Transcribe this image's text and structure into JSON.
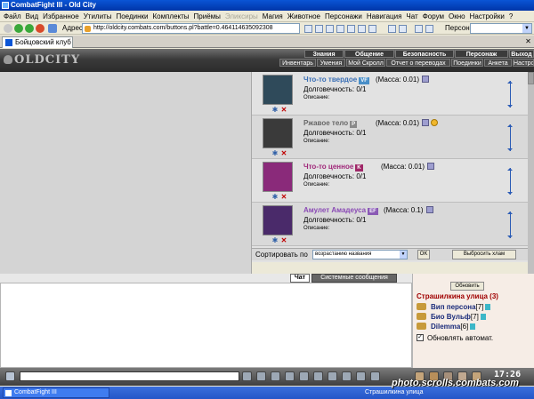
{
  "window": {
    "title": "CombatFight III - Old City"
  },
  "menu": [
    "Файл",
    "Вид",
    "Избранное",
    "Утилиты",
    "Поединки",
    "Комплекты",
    "Приёмы",
    "Эликсиры",
    "Магия",
    "Животное",
    "Персонажи",
    "Навигация",
    "Чат",
    "Форум",
    "Окно",
    "Настройки",
    "?"
  ],
  "address": {
    "label": "Адрес",
    "url": "http://oldcity.combats.com/buttons.pl?battle=0.464114635092308",
    "persona_label": "Персонаж:"
  },
  "tab": {
    "label": "Бойцовский клуб"
  },
  "game": {
    "logo": "OLDCITY",
    "nav_top": [
      "Знания",
      "Общение",
      "Безопасность",
      "Персонаж",
      "Выход"
    ],
    "nav_bottom": [
      "Инвентарь",
      "Умения",
      "Мой Скролл",
      "Отчет о переводах",
      "Поединки",
      "Анкета",
      "Настро"
    ]
  },
  "inventory": {
    "mass_label": "Масса:",
    "durability_label": "Долговечность:",
    "description_label": "Описание:",
    "items": [
      {
        "name": "Что-то твердое",
        "badge": "VF",
        "badge_color": "#4a8fc8",
        "name_color": "#3a6fb5",
        "mass": "(Масса: 0.01)",
        "durability": "0/1",
        "img_color": "#2f4a5a"
      },
      {
        "name": "Ржавое тело",
        "badge": "P",
        "badge_color": "#8a8a8a",
        "name_color": "#666666",
        "mass": "(Масса: 0.01)",
        "durability": "0/1",
        "img_color": "#3a3a3a"
      },
      {
        "name": "Что-то ценное",
        "badge": "K",
        "badge_color": "#a02868",
        "name_color": "#a0287a",
        "mass": "(Масса: 0.01)",
        "durability": "0/1",
        "img_color": "#8a2a7a"
      },
      {
        "name": "Амулет Амадеуса",
        "badge": "EF",
        "badge_color": "#8a5ab5",
        "name_color": "#8a4ab5",
        "mass": "(Масса: 0.1)",
        "durability": "0/1",
        "img_color": "#4a2a6a"
      }
    ],
    "sort_label": "Сортировать по",
    "sort_value": "возрастанию названия",
    "ok_label": "OK",
    "junk_label": "Выбросить хлам"
  },
  "chat": {
    "tab_chat": "Чат",
    "tab_system": "Системные сообщения"
  },
  "users": {
    "refresh_label": "Обновить",
    "location": "Страшилкина улица (3)",
    "list": [
      {
        "name": "Вип персона",
        "level": "[7]"
      },
      {
        "name": "Био Вульф",
        "level": "[7]"
      },
      {
        "name": "Dilemma",
        "level": "[6]"
      }
    ],
    "auto_label": "Обновлять автомат."
  },
  "toolbar": {
    "clock": "17:26"
  },
  "taskbar": {
    "app": "CombatFight III",
    "location": "Страшилкина улица"
  },
  "watermark": "photo.scrolls.combats.com"
}
